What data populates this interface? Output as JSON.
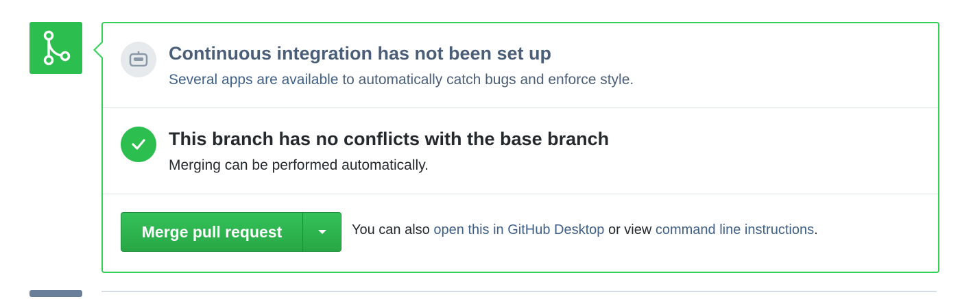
{
  "colors": {
    "accent_green": "#2cbe4e",
    "border_green": "#34d058",
    "link_blue": "#3e5f88",
    "muted_text": "#4b5e78"
  },
  "merge_badge": {
    "icon": "git-merge-icon"
  },
  "ci": {
    "icon": "ci-robot-icon",
    "title": "Continuous integration has not been set up",
    "subtitle_link": "Several apps are available",
    "subtitle_rest": " to automatically catch bugs and enforce style."
  },
  "conflicts": {
    "icon": "check-icon",
    "title": "This branch has no conflicts with the base branch",
    "subtitle": "Merging can be performed automatically."
  },
  "actions": {
    "merge_button_label": "Merge pull request",
    "dropdown_icon": "caret-down-icon",
    "alt_prefix": "You can also ",
    "desktop_link": "open this in GitHub Desktop",
    "alt_middle": " or view ",
    "cli_link": "command line instructions",
    "alt_suffix": "."
  }
}
